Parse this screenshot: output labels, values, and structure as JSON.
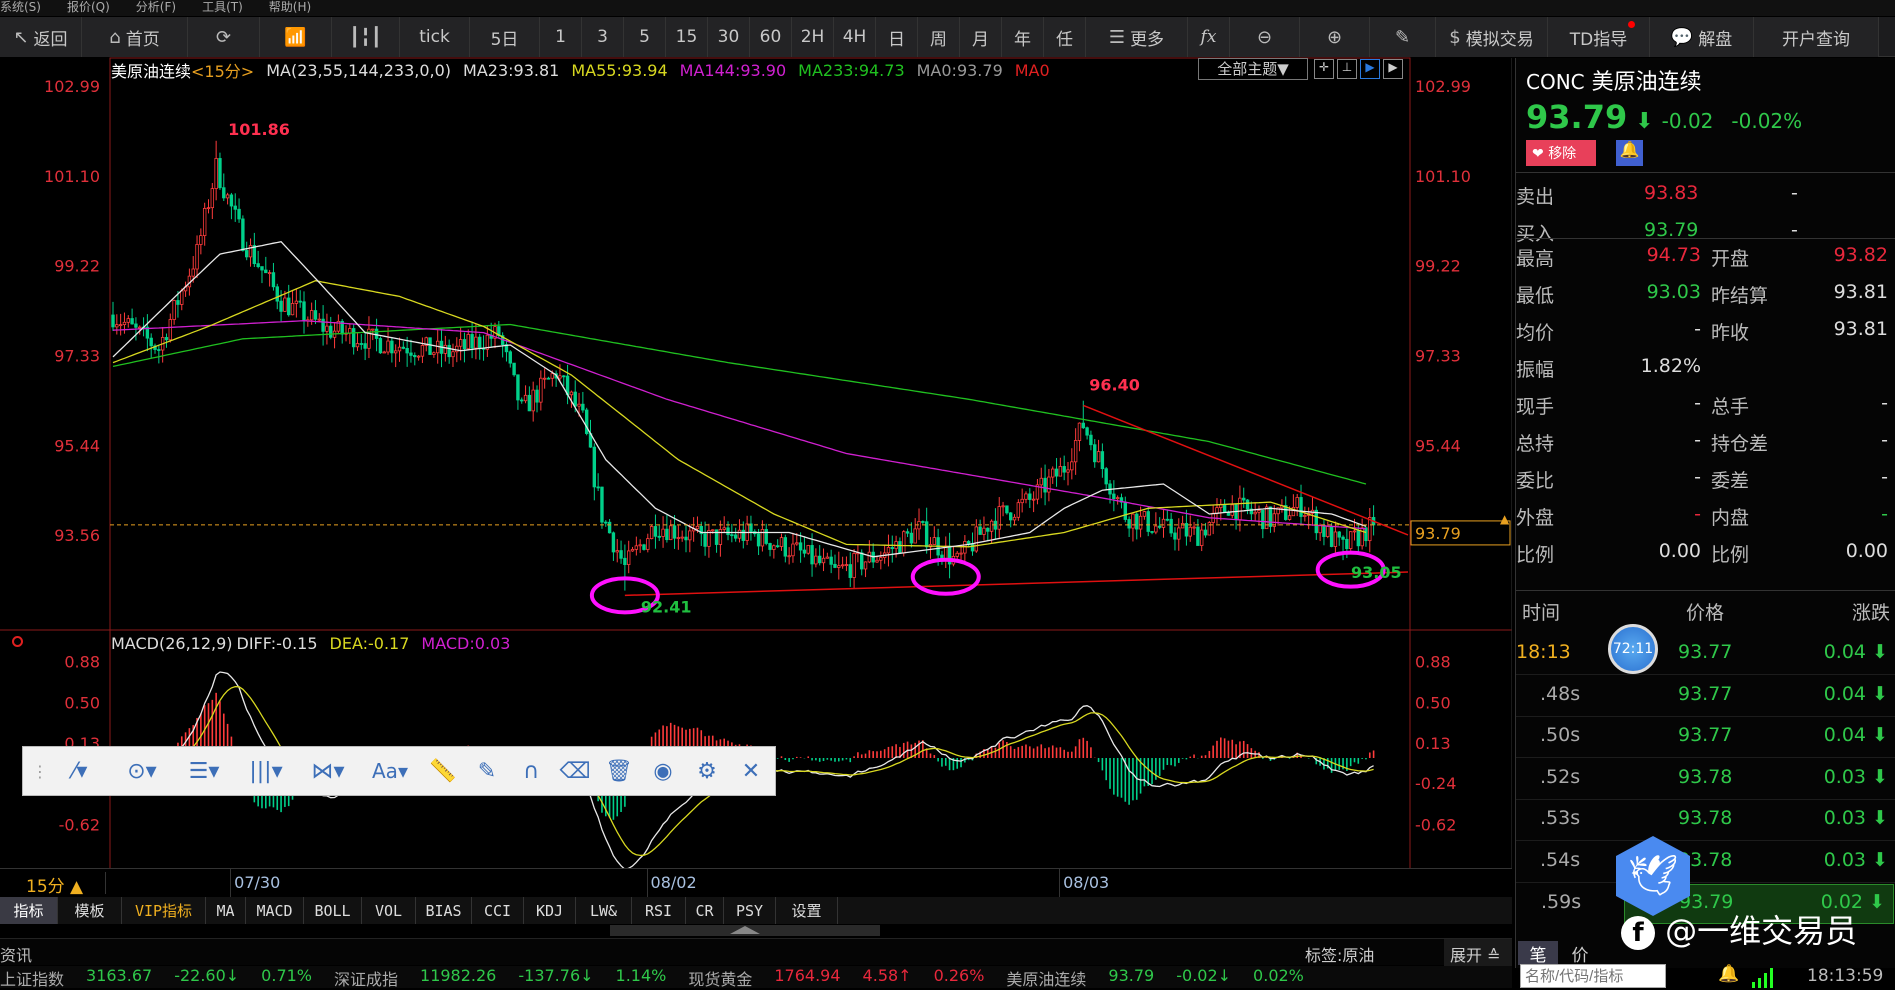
{
  "menu": [
    "系统(S)",
    "报价(Q)",
    "分析(F)",
    "工具(T)",
    "帮助(H)"
  ],
  "toolbar": [
    {
      "label": "返回",
      "icon": "back-arrow-icon",
      "w": 82
    },
    {
      "label": "首页",
      "icon": "home-icon",
      "w": 106
    },
    {
      "label": "",
      "icon": "refresh-icon",
      "w": 72
    },
    {
      "label": "",
      "icon": "bar-chart-icon",
      "w": 72
    },
    {
      "label": "",
      "icon": "candlestick-icon",
      "w": 68
    },
    {
      "label": "tick",
      "icon": "",
      "w": 70
    },
    {
      "label": "5日",
      "icon": "",
      "w": 70
    },
    {
      "label": "1",
      "icon": "",
      "w": 42
    },
    {
      "label": "3",
      "icon": "",
      "w": 42
    },
    {
      "label": "5",
      "icon": "",
      "w": 42
    },
    {
      "label": "15",
      "icon": "",
      "w": 42
    },
    {
      "label": "30",
      "icon": "",
      "w": 42
    },
    {
      "label": "60",
      "icon": "",
      "w": 42
    },
    {
      "label": "2H",
      "icon": "",
      "w": 42
    },
    {
      "label": "4H",
      "icon": "",
      "w": 42
    },
    {
      "label": "日",
      "icon": "",
      "w": 42
    },
    {
      "label": "周",
      "icon": "",
      "w": 42
    },
    {
      "label": "月",
      "icon": "",
      "w": 42
    },
    {
      "label": "年",
      "icon": "",
      "w": 42
    },
    {
      "label": "任",
      "icon": "",
      "w": 42
    },
    {
      "label": "更多",
      "icon": "list-icon",
      "w": 102
    },
    {
      "label": "fx",
      "icon": "",
      "w": 42
    },
    {
      "label": "",
      "icon": "zoom-out-icon",
      "w": 70
    },
    {
      "label": "",
      "icon": "zoom-in-icon",
      "w": 70
    },
    {
      "label": "",
      "icon": "pencil-icon",
      "w": 66
    },
    {
      "label": "模拟交易",
      "icon": "dollar-icon",
      "w": 112
    },
    {
      "label": "TD指导",
      "icon": "",
      "w": 102
    },
    {
      "label": "解盘",
      "icon": "chat-icon",
      "w": 104
    },
    {
      "label": "开户查询",
      "icon": "",
      "w": 125
    }
  ],
  "header": {
    "name": "美原油连续",
    "period": "<15分>",
    "ma_params": "MA(23,55,144,233,0,0)",
    "ma23": "MA23:93.81",
    "ma55": "MA55:93.94",
    "ma144": "MA144:93.90",
    "ma233": "MA233:94.73",
    "ma0": "MA0:93.79",
    "ma0b": "MA0",
    "theme": "全部主题▼"
  },
  "colors": {
    "up": "#ff3b3b",
    "down": "#00d08a",
    "ma23": "#e8e8e8",
    "ma55": "#d8d820",
    "ma144": "#d020d0",
    "ma233": "#20c020",
    "trend": "#e01010",
    "ellipse": "#ff10ff"
  },
  "price_axis": [
    "102.99",
    "101.10",
    "99.22",
    "97.33",
    "95.44",
    "93.56"
  ],
  "price_axis_values": [
    102.99,
    101.1,
    99.22,
    97.33,
    95.44,
    93.56
  ],
  "current_price": "93.79",
  "current_price_value": 93.79,
  "annotations": {
    "high": "101.86",
    "low": "92.41",
    "mid_high": "96.40",
    "recent_low": "93.05"
  },
  "price_path": [
    [
      0,
      98.2
    ],
    [
      12,
      97.5
    ],
    [
      22,
      99.5
    ],
    [
      27,
      101.3
    ],
    [
      34,
      99.8
    ],
    [
      44,
      98.5
    ],
    [
      56,
      97.9
    ],
    [
      72,
      97.6
    ],
    [
      88,
      97.4
    ],
    [
      101,
      97.8
    ],
    [
      107,
      96.2
    ],
    [
      116,
      97.0
    ],
    [
      123,
      96.0
    ],
    [
      128,
      94.0
    ],
    [
      134,
      92.9
    ],
    [
      142,
      93.8
    ],
    [
      154,
      93.5
    ],
    [
      167,
      93.6
    ],
    [
      180,
      93.2
    ],
    [
      189,
      92.8
    ],
    [
      202,
      93.2
    ],
    [
      211,
      93.7
    ],
    [
      221,
      93.0
    ],
    [
      230,
      93.9
    ],
    [
      240,
      94.3
    ],
    [
      249,
      95.0
    ],
    [
      254,
      95.9
    ],
    [
      259,
      95.0
    ],
    [
      265,
      94.0
    ],
    [
      275,
      93.7
    ],
    [
      284,
      93.6
    ],
    [
      292,
      94.2
    ],
    [
      303,
      93.9
    ],
    [
      311,
      94.2
    ],
    [
      319,
      93.5
    ],
    [
      322,
      93.3
    ],
    [
      330,
      93.79
    ]
  ],
  "ma_paths": {
    "ma233": [
      [
        0,
        97.12
      ],
      [
        34,
        97.7
      ],
      [
        104,
        98.0
      ],
      [
        161,
        97.2
      ],
      [
        224,
        96.43
      ],
      [
        287,
        95.54
      ],
      [
        328,
        94.65
      ]
    ],
    "ma144": [
      [
        0,
        97.88
      ],
      [
        50,
        98.08
      ],
      [
        97,
        97.83
      ],
      [
        145,
        96.43
      ],
      [
        192,
        95.29
      ],
      [
        256,
        94.4
      ],
      [
        287,
        93.94
      ],
      [
        328,
        93.71
      ]
    ],
    "ma55": [
      [
        0,
        97.2
      ],
      [
        25,
        97.96
      ],
      [
        53,
        98.92
      ],
      [
        75,
        98.59
      ],
      [
        97,
        97.96
      ],
      [
        120,
        96.94
      ],
      [
        148,
        95.16
      ],
      [
        173,
        94.02
      ],
      [
        192,
        93.38
      ],
      [
        224,
        93.33
      ],
      [
        249,
        93.63
      ],
      [
        271,
        94.14
      ],
      [
        303,
        94.27
      ],
      [
        328,
        93.63
      ]
    ],
    "ma23": [
      [
        0,
        97.32
      ],
      [
        18,
        98.72
      ],
      [
        28,
        99.48
      ],
      [
        44,
        99.74
      ],
      [
        53,
        98.97
      ],
      [
        66,
        97.83
      ],
      [
        91,
        97.45
      ],
      [
        104,
        97.57
      ],
      [
        116,
        96.94
      ],
      [
        129,
        95.16
      ],
      [
        142,
        94.14
      ],
      [
        154,
        93.63
      ],
      [
        177,
        93.63
      ],
      [
        199,
        93.12
      ],
      [
        224,
        93.38
      ],
      [
        240,
        93.63
      ],
      [
        249,
        94.14
      ],
      [
        259,
        94.52
      ],
      [
        275,
        94.65
      ],
      [
        287,
        94.02
      ],
      [
        303,
        94.14
      ],
      [
        319,
        94.02
      ],
      [
        328,
        93.76
      ]
    ]
  },
  "trendlines": [
    [
      [
        134,
        92.31
      ],
      [
        339,
        92.8
      ]
    ],
    [
      [
        254,
        96.3
      ],
      [
        339,
        93.58
      ]
    ]
  ],
  "ellipses": [
    [
      134,
      92.31
    ],
    [
      218,
      92.7
    ],
    [
      324,
      92.85
    ]
  ],
  "macd": {
    "title": "MACD(26,12,9)",
    "diff": "DIFF:-0.15",
    "dea": "DEA:-0.17",
    "macd": "MACD:0.03",
    "axis": [
      "0.88",
      "0.50",
      "0.13",
      "-0.24",
      "-0.62"
    ],
    "axis_values": [
      0.88,
      0.5,
      0.13,
      -0.24,
      -0.62
    ]
  },
  "drawbar": [
    {
      "g": "⁄▾",
      "n": "line-tool-icon"
    },
    {
      "g": "⊙▾",
      "n": "circle-tool-icon"
    },
    {
      "g": "☰▾",
      "n": "fib-tool-icon"
    },
    {
      "g": "|||▾",
      "n": "channel-tool-icon"
    },
    {
      "g": "⋈▾",
      "n": "pattern-tool-icon"
    },
    {
      "g": "Aa▾",
      "n": "text-tool-icon"
    },
    {
      "g": "📏",
      "n": "ruler-icon"
    },
    {
      "g": "✎",
      "n": "pen-icon"
    },
    {
      "g": "∩",
      "n": "magnet-icon"
    },
    {
      "g": "⌫",
      "n": "eraser-icon"
    },
    {
      "g": "🗑",
      "n": "trash-icon"
    },
    {
      "g": "◉",
      "n": "eye-icon"
    },
    {
      "g": "⚙",
      "n": "settings-icon"
    },
    {
      "g": "✕",
      "n": "close-icon"
    }
  ],
  "period_label": "15分 ▲",
  "dates": [
    {
      "t": "07/30",
      "i": 38
    },
    {
      "t": "08/02",
      "i": 147
    },
    {
      "t": "08/03",
      "i": 255
    }
  ],
  "tabs": [
    {
      "t": "指标",
      "w": 58,
      "active": true
    },
    {
      "t": "模板",
      "w": 64
    },
    {
      "t": "VIP指标",
      "w": 84,
      "vip": true
    },
    {
      "t": "MA",
      "w": 40
    },
    {
      "t": "MACD",
      "w": 58
    },
    {
      "t": "BOLL",
      "w": 58
    },
    {
      "t": "VOL",
      "w": 54
    },
    {
      "t": "BIAS",
      "w": 56
    },
    {
      "t": "CCI",
      "w": 52
    },
    {
      "t": "KDJ",
      "w": 52
    },
    {
      "t": "LW&",
      "w": 56
    },
    {
      "t": "RSI",
      "w": 54
    },
    {
      "t": "CR",
      "w": 38
    },
    {
      "t": "PSY",
      "w": 52
    },
    {
      "t": "设置",
      "w": 62
    }
  ],
  "news": {
    "label": "资讯",
    "tag": "标签:原油",
    "expand": "展开 ≙"
  },
  "quote": {
    "code": "CONC",
    "name": "美原油连续",
    "price": "93.79",
    "change": "-0.02",
    "pct": "-0.02%",
    "remove": "移除",
    "bidask": [
      {
        "l": "卖出",
        "v": "93.83",
        "c": "rd",
        "x": "-"
      },
      {
        "l": "买入",
        "v": "93.79",
        "c": "gr",
        "x": "-"
      }
    ],
    "stats": [
      {
        "l1": "最高",
        "v1": "94.73",
        "c1": "rd",
        "l2": "开盘",
        "v2": "93.82",
        "c2": "rd"
      },
      {
        "l1": "最低",
        "v1": "93.03",
        "c1": "gr",
        "l2": "昨结算",
        "v2": "93.81",
        "c2": "wh"
      },
      {
        "l1": "均价",
        "v1": "-",
        "c1": "wh",
        "l2": "昨收",
        "v2": "93.81",
        "c2": "wh"
      },
      {
        "l1": "振幅",
        "v1": "1.82%",
        "c1": "wh",
        "l2": "",
        "v2": "",
        "c2": "wh"
      },
      {
        "l1": "现手",
        "v1": "-",
        "c1": "wh",
        "l2": "总手",
        "v2": "-",
        "c2": "wh"
      },
      {
        "l1": "总持",
        "v1": "-",
        "c1": "wh",
        "l2": "持仓差",
        "v2": "-",
        "c2": "wh"
      },
      {
        "l1": "委比",
        "v1": "-",
        "c1": "wh",
        "l2": "委差",
        "v2": "-",
        "c2": "wh"
      },
      {
        "l1": "外盘",
        "v1": "-",
        "c1": "rd",
        "l2": "内盘",
        "v2": "-",
        "c2": "gr"
      },
      {
        "l1": "比例",
        "v1": "0.00",
        "c1": "wh",
        "l2": "比例",
        "v2": "0.00",
        "c2": "wh"
      }
    ]
  },
  "ticks": {
    "headers": [
      "时间",
      "价格",
      "涨跌"
    ],
    "timer": "72:11",
    "rows": [
      {
        "t": "18:13",
        "p": "93.77",
        "c": "0.04"
      },
      {
        "t": ".48s",
        "p": "93.77",
        "c": "0.04"
      },
      {
        "t": ".50s",
        "p": "93.77",
        "c": "0.04"
      },
      {
        "t": ".52s",
        "p": "93.78",
        "c": "0.03"
      },
      {
        "t": ".53s",
        "p": "93.78",
        "c": "0.03"
      },
      {
        "t": ".54s",
        "p": "93.78",
        "c": "0.03"
      },
      {
        "t": ".59s",
        "p": "93.79",
        "c": "0.02"
      }
    ],
    "tab1": "笔",
    "tab2": "价"
  },
  "watermark": "@一维交易员",
  "search_placeholder": "名称/代码/指标",
  "clock": "18:13:59",
  "ticker": [
    {
      "n": "上证指数",
      "v": "3163.67",
      "c": "-22.60↓",
      "p": "0.71%",
      "col": "gr"
    },
    {
      "n": "深证成指",
      "v": "11982.26",
      "c": "-137.76↓",
      "p": "1.14%",
      "col": "gr"
    },
    {
      "n": "现货黄金",
      "v": "1764.94",
      "c": "4.58↑",
      "p": "0.26%",
      "col": "rd"
    },
    {
      "n": "美原油连续",
      "v": "93.79",
      "c": "-0.02↓",
      "p": "0.02%",
      "col": "gr"
    }
  ]
}
